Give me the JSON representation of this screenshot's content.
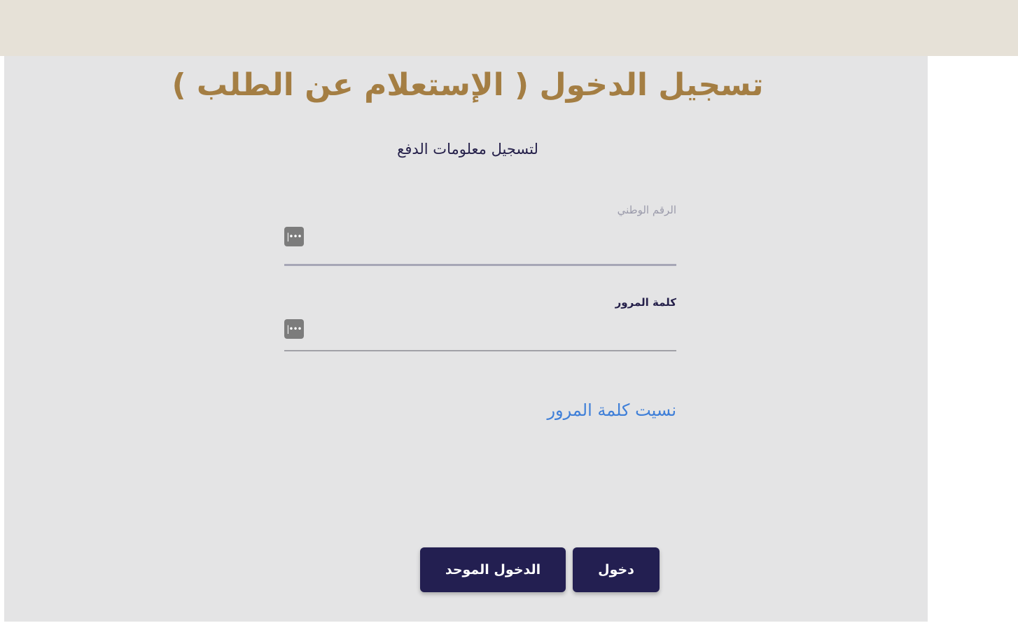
{
  "header": {
    "title": "تسجيل الدخول ( الإستعلام عن الطلب )",
    "subtitle": "لتسجيل معلومات الدفع"
  },
  "form": {
    "national_id": {
      "label": "الرقم الوطني",
      "value": "",
      "icon": "key-icon"
    },
    "password": {
      "label": "كلمة المرور",
      "value": "",
      "icon": "key-icon"
    },
    "forgot_password": "نسيت كلمة المرور"
  },
  "actions": {
    "login_label": "دخول",
    "unified_login_label": "الدخول الموحد"
  },
  "colors": {
    "title": "#a47e43",
    "button": "#231f51",
    "link": "#3f7fd8",
    "panel": "#e4e4e5",
    "topbar": "#e6e1d7"
  }
}
